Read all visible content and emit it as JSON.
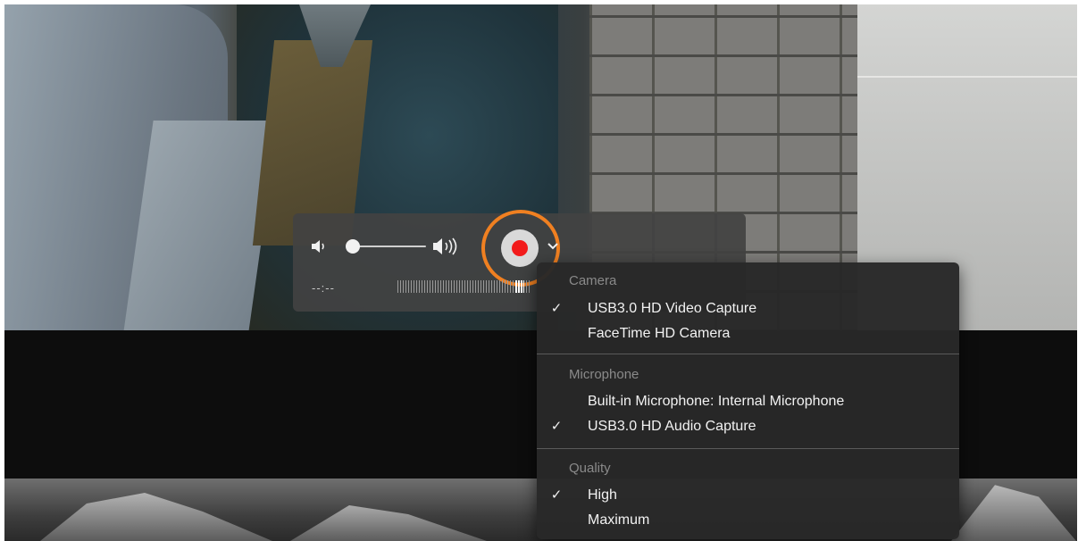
{
  "controls": {
    "time": "--:--",
    "volume_level": 0.0,
    "icons": {
      "volume_low": "speaker-low-icon",
      "volume_high": "speaker-high-icon",
      "record": "record-icon",
      "options": "chevron-down-icon"
    },
    "record_color": "#f21b1b",
    "highlight_color": "#f08021"
  },
  "menu": {
    "sections": [
      {
        "header": "Camera",
        "items": [
          {
            "label": "USB3.0 HD Video Capture",
            "checked": true
          },
          {
            "label": "FaceTime HD Camera",
            "checked": false
          }
        ]
      },
      {
        "header": "Microphone",
        "items": [
          {
            "label": "Built-in Microphone: Internal Microphone",
            "checked": false
          },
          {
            "label": "USB3.0 HD Audio Capture",
            "checked": true
          }
        ]
      },
      {
        "header": "Quality",
        "items": [
          {
            "label": "High",
            "checked": true
          },
          {
            "label": "Maximum",
            "checked": false
          }
        ]
      }
    ],
    "check_mark": "✓"
  }
}
